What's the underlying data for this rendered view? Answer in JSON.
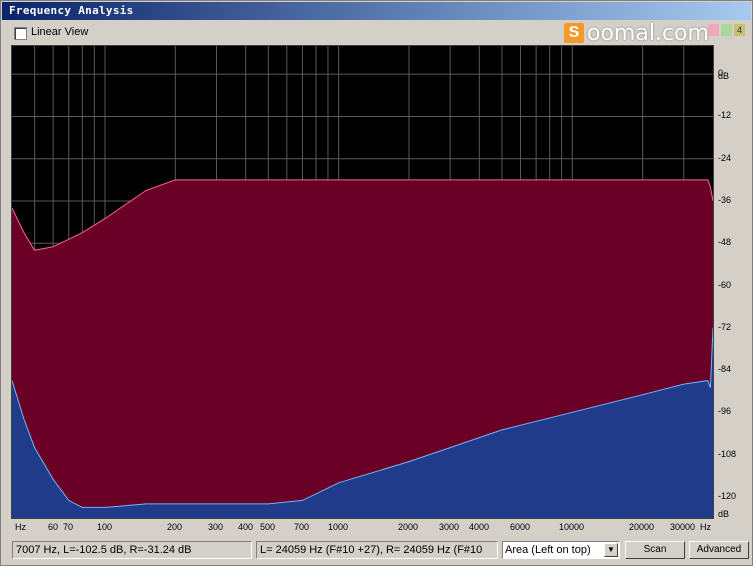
{
  "window": {
    "title": "Frequency Analysis"
  },
  "toolbar": {
    "linear_view_label": "Linear View",
    "linear_view_checked": false
  },
  "watermark": {
    "brand": "Soomal.com",
    "brand_mark": "S",
    "buttons": [
      "",
      "",
      "4"
    ]
  },
  "db_axis": {
    "unit": "dB",
    "ticks": [
      "0",
      "-12",
      "-24",
      "-36",
      "-48",
      "-60",
      "-72",
      "-84",
      "-96",
      "-108",
      "-120"
    ],
    "bottom_unit": "dB"
  },
  "hz_axis": {
    "unit_left": "Hz",
    "unit_right": "Hz",
    "ticks": [
      "60",
      "70",
      "100",
      "200",
      "300",
      "400",
      "500",
      "700",
      "1000",
      "2000",
      "3000",
      "4000",
      "6000",
      "10000",
      "20000",
      "30000"
    ]
  },
  "status": {
    "cursor_readout": "7007 Hz, L=-102.5 dB, R=-31.24 dB",
    "peak_readout": "L=  24059 Hz (F#10 +27), R=  24059 Hz (F#10",
    "display_mode": "Area (Left on top)",
    "scan_label": "Scan",
    "advanced_label": "Advanced"
  },
  "colors": {
    "plot_bg": "#000000",
    "grid": "#5a5a5a",
    "left_fill": "#6a0026",
    "left_line": "#ff5fa0",
    "right_fill": "#1f3b8a",
    "right_line": "#6fb4ff"
  },
  "chart_data": {
    "type": "area",
    "title": "",
    "xlabel": "Hz",
    "ylabel": "dB",
    "x_scale": "log",
    "xlim": [
      40,
      40000
    ],
    "ylim": [
      -126,
      8
    ],
    "grid": true,
    "series": [
      {
        "values_x": [
          40,
          45,
          50,
          60,
          80,
          100,
          150,
          200,
          500,
          1000,
          5000,
          10000,
          20000,
          30000,
          38000,
          39000,
          40000
        ],
        "values_y": [
          -38,
          -45,
          -50,
          -49,
          -45,
          -41,
          -33,
          -30,
          -30,
          -30,
          -30,
          -30,
          -30,
          -30,
          -30,
          -32,
          -36
        ]
      },
      {
        "values_x": [
          40,
          45,
          50,
          60,
          70,
          80,
          100,
          150,
          200,
          500,
          700,
          1000,
          2000,
          3000,
          5000,
          10000,
          20000,
          30000,
          38000,
          39000,
          40000
        ],
        "values_y": [
          -87,
          -98,
          -106,
          -115,
          -121,
          -123,
          -123,
          -122,
          -122,
          -122,
          -121,
          -116,
          -110,
          -106,
          -101,
          -96,
          -91,
          -88,
          -87,
          -89,
          -72
        ]
      }
    ]
  }
}
